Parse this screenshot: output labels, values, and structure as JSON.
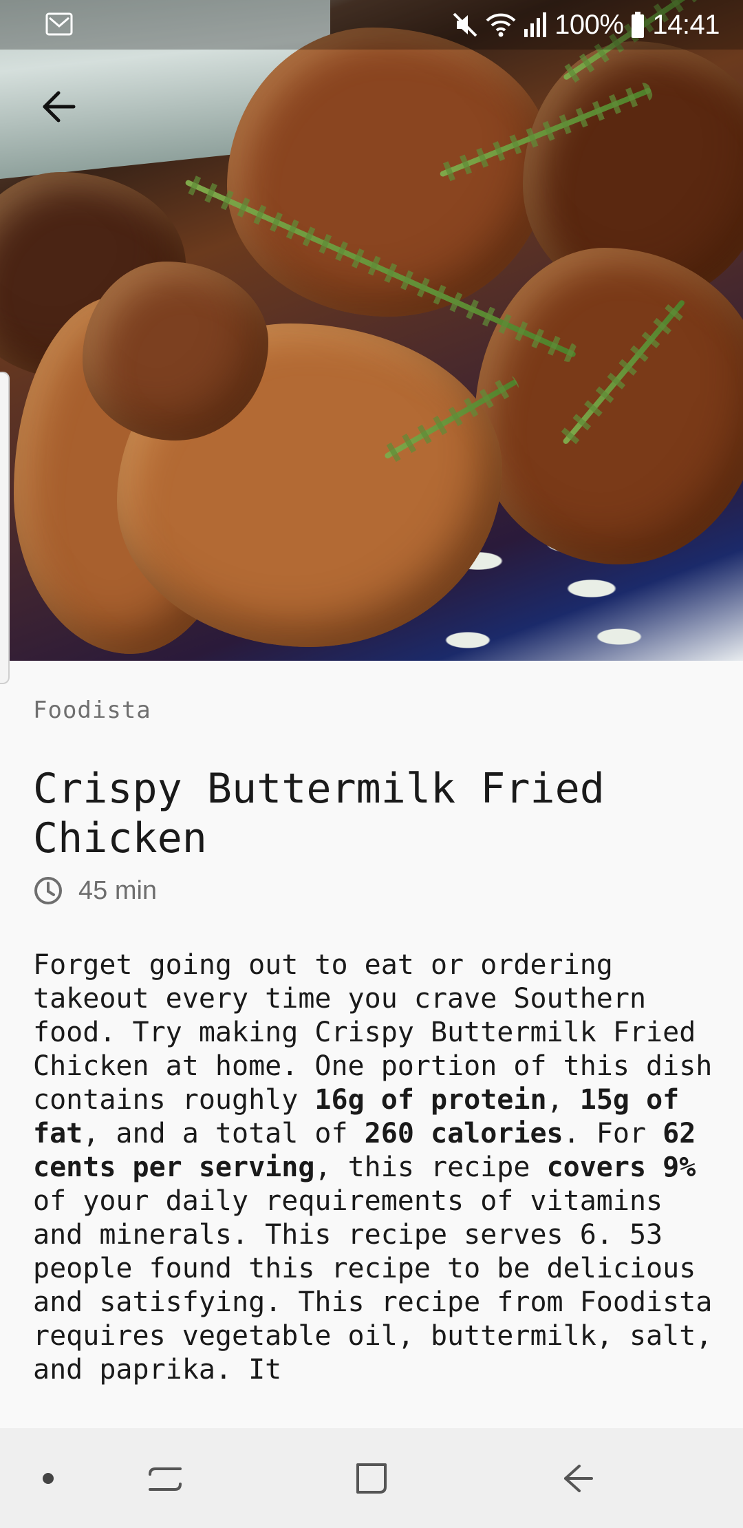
{
  "status_bar": {
    "battery": "100%",
    "time": "14:41",
    "icons": [
      "mail-icon",
      "mute-icon",
      "wifi-icon",
      "signal-icon",
      "battery-icon"
    ]
  },
  "toolbar": {
    "back_icon": "arrow-left-icon"
  },
  "recipe": {
    "source": "Foodista",
    "title": "Crispy Buttermilk Fried Chicken",
    "time_icon": "clock-icon",
    "time": "45 min",
    "description": {
      "p1": "Forget going out to eat or ordering takeout every time you crave Southern food. Try making Crispy Buttermilk Fried Chicken at home. One portion of this dish contains roughly ",
      "protein": "16g of protein",
      "sep1": ", ",
      "fat": "15g of fat",
      "p2": ", and a total of ",
      "calories": "260 calories",
      "p3": ". For ",
      "cost": "62 cents per serving",
      "p4": ", this recipe ",
      "covers": "covers 9%",
      "p5": " of your daily requirements of vitamins and minerals. This recipe serves 6. 53 people found this recipe to be delicious and satisfying. This recipe from Foodista requires vegetable oil, buttermilk, salt, and paprika. It"
    }
  },
  "nav_bar": {
    "icons": [
      "dot-icon",
      "recents-icon",
      "home-icon",
      "back-icon"
    ]
  },
  "colors": {
    "background": "#f9f9f9",
    "text": "#1a1a1a",
    "muted": "#6e6e6e",
    "nav_background": "#efefef"
  }
}
